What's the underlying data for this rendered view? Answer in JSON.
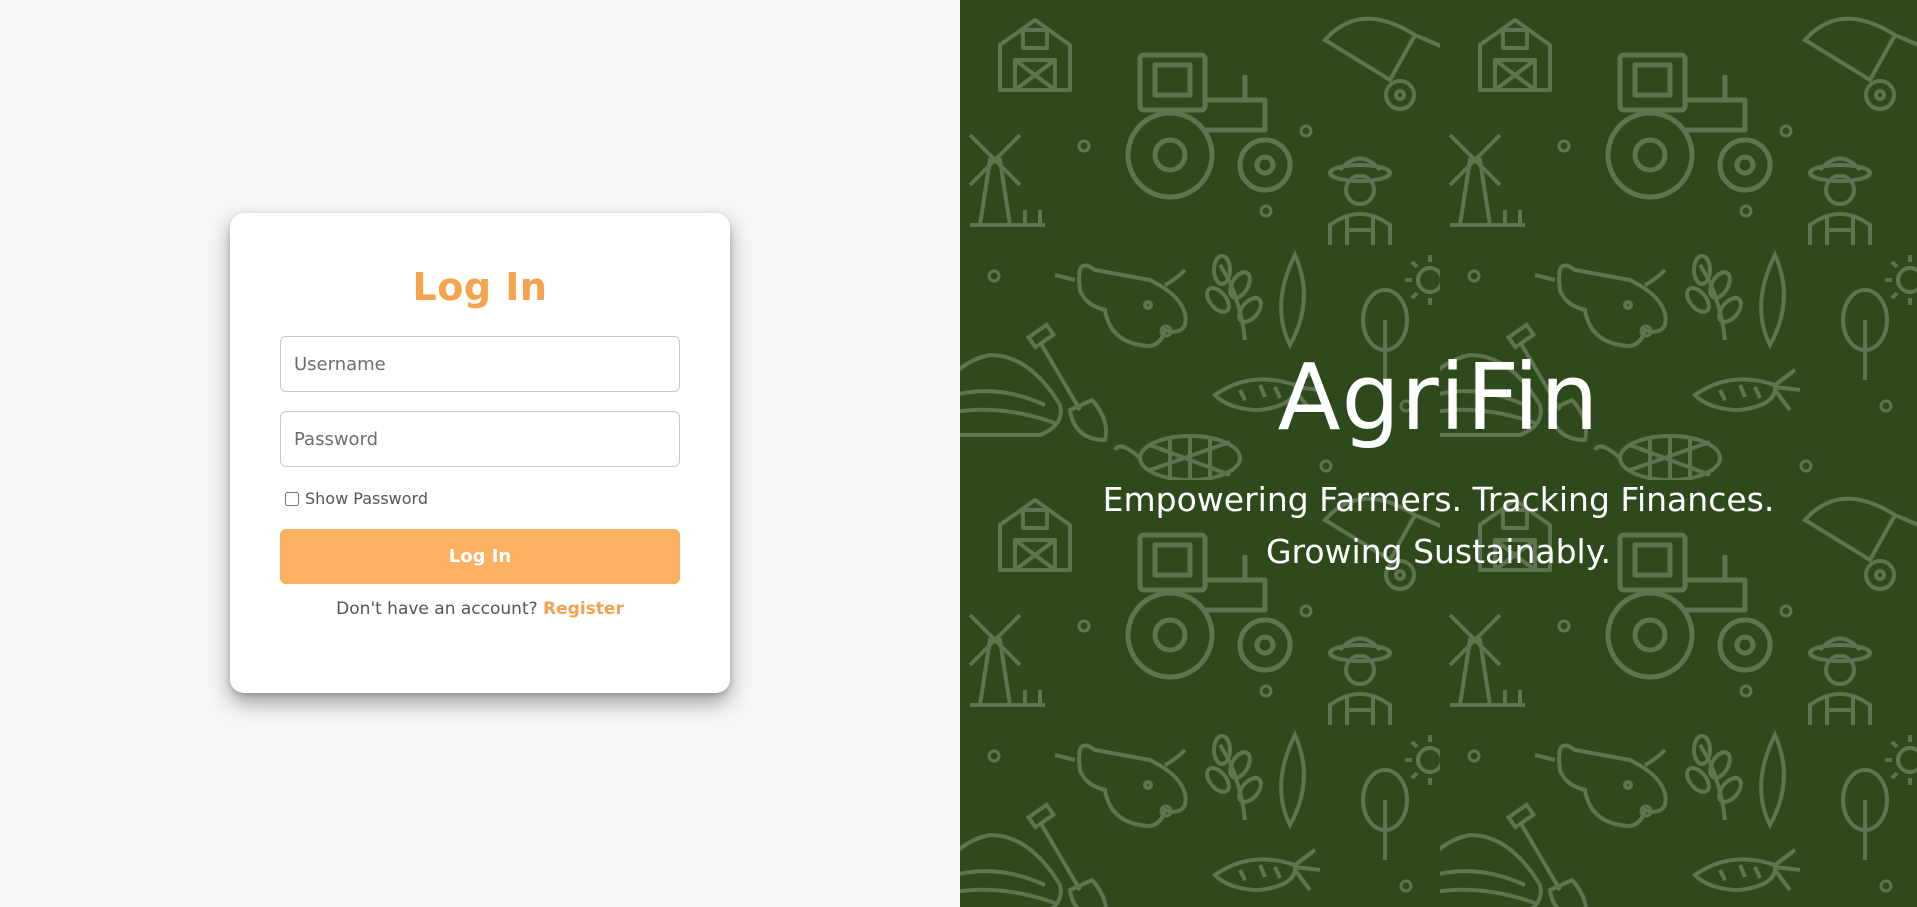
{
  "login": {
    "title": "Log In",
    "username_placeholder": "Username",
    "password_placeholder": "Password",
    "show_password_label": "Show Password",
    "submit_label": "Log In",
    "register_prompt": "Don't have an account?",
    "register_link": "Register"
  },
  "hero": {
    "brand": "AgriFin",
    "tagline_line1": "Empowering Farmers. Tracking Finances.",
    "tagline_line2": "Growing Sustainably."
  },
  "colors": {
    "accent": "#f6a24e",
    "button": "#fcb062",
    "hero_background": "#2e4a1d",
    "pattern_stroke": "#5f7350",
    "page_background": "#f6f6f6"
  },
  "pattern_icons": [
    "barn-icon",
    "tractor-icon",
    "wheelbarrow-icon",
    "windmill-icon",
    "farmer-icon",
    "cow-icon",
    "wheat-icon",
    "leaf-icon",
    "tree-icon",
    "sun-icon",
    "shovel-icon",
    "carrot-icon",
    "corn-icon",
    "field-icon"
  ]
}
